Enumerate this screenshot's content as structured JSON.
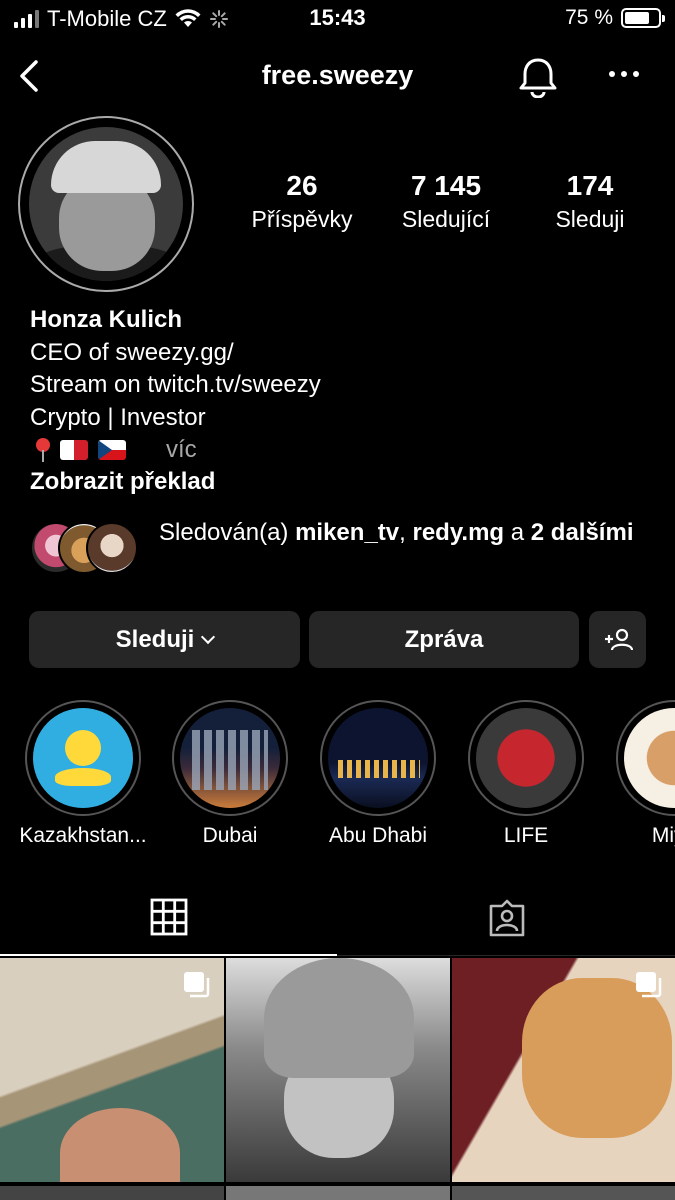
{
  "status_bar": {
    "carrier": "T-Mobile CZ",
    "time": "15:43",
    "battery_text": "75 %",
    "battery_level": 0.75
  },
  "header": {
    "username": "free.sweezy",
    "icons": [
      "back-icon",
      "bell-icon",
      "more-icon"
    ]
  },
  "stats": [
    {
      "value": "26",
      "label": "Příspěvky"
    },
    {
      "value": "7 145",
      "label": "Sledující"
    },
    {
      "value": "174",
      "label": "Sleduji"
    }
  ],
  "bio": {
    "name": "Honza Kulich",
    "lines": [
      "CEO of sweezy.gg/",
      "Stream on twitch.tv/sweezy",
      "Crypto | Investor"
    ],
    "more": "víc",
    "translate": "Zobrazit překlad"
  },
  "followed_by": {
    "prefix": "Sledován(a) ",
    "user1": "miken_tv",
    "sep": ", ",
    "user2": "redy.mg",
    "and": " a ",
    "others": "2 dalšími"
  },
  "buttons": {
    "follow": "Sleduji",
    "message": "Zpráva"
  },
  "highlights": [
    {
      "label": "Kazakhstan..."
    },
    {
      "label": "Dubai"
    },
    {
      "label": "Abu Dhabi"
    },
    {
      "label": "LIFE"
    },
    {
      "label": "Miya"
    }
  ],
  "colors": {
    "background": "#000000",
    "button_bg": "#262626",
    "muted_text": "#a8a8a8"
  }
}
